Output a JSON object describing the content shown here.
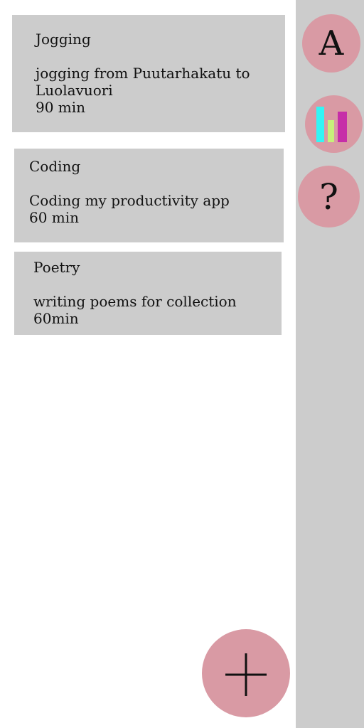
{
  "sidebar": {
    "font_button_label": "A",
    "stats_icon": "bar-chart-icon",
    "help_button_label": "?",
    "stats_colors": [
      "#33f5f5",
      "#c7f07a",
      "#c62ea8"
    ]
  },
  "activities": [
    {
      "title": "Jogging",
      "description": "jogging from Puutarhakatu to Luolavuori",
      "duration": "90 min"
    },
    {
      "title": "Coding",
      "description": "Coding my productivity app",
      "duration": "60 min"
    },
    {
      "title": "Poetry",
      "description": "writing poems for collection",
      "duration": "60min"
    }
  ],
  "fab": {
    "icon": "plus-icon"
  },
  "colors": {
    "card_bg": "#cccccc",
    "sidebar_bg": "#cccccc",
    "button_pink": "#d99aa4",
    "text": "#111111"
  }
}
